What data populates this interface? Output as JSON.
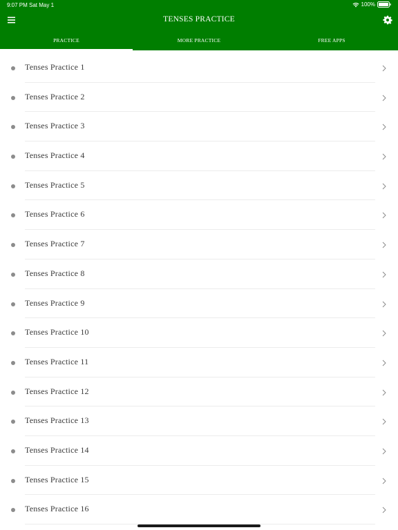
{
  "status_bar": {
    "time": "9:07 PM",
    "date": "Sat May 1",
    "battery": "100%"
  },
  "header": {
    "title": "TENSES PRACTICE",
    "menu_icon": "hamburger-menu-icon",
    "settings_icon": "gear-icon"
  },
  "tabs": [
    {
      "label": "PRACTICE",
      "active": true
    },
    {
      "label": "MORE PRACTICE",
      "active": false
    },
    {
      "label": "FREE APPS",
      "active": false
    }
  ],
  "list": {
    "items": [
      {
        "label": "Tenses Practice 1"
      },
      {
        "label": "Tenses Practice 2"
      },
      {
        "label": "Tenses Practice 3"
      },
      {
        "label": "Tenses Practice 4"
      },
      {
        "label": "Tenses Practice 5"
      },
      {
        "label": "Tenses Practice 6"
      },
      {
        "label": "Tenses Practice 7"
      },
      {
        "label": "Tenses Practice 8"
      },
      {
        "label": "Tenses Practice 9"
      },
      {
        "label": "Tenses Practice 10"
      },
      {
        "label": "Tenses Practice 11"
      },
      {
        "label": "Tenses Practice 12"
      },
      {
        "label": "Tenses Practice 13"
      },
      {
        "label": "Tenses Practice 14"
      },
      {
        "label": "Tenses Practice 15"
      },
      {
        "label": "Tenses Practice 16"
      }
    ]
  },
  "colors": {
    "header_bg": "#007e00",
    "header_text": "#ffffff",
    "bullet": "#8c8c8c",
    "item_text": "#3a3a3a"
  }
}
